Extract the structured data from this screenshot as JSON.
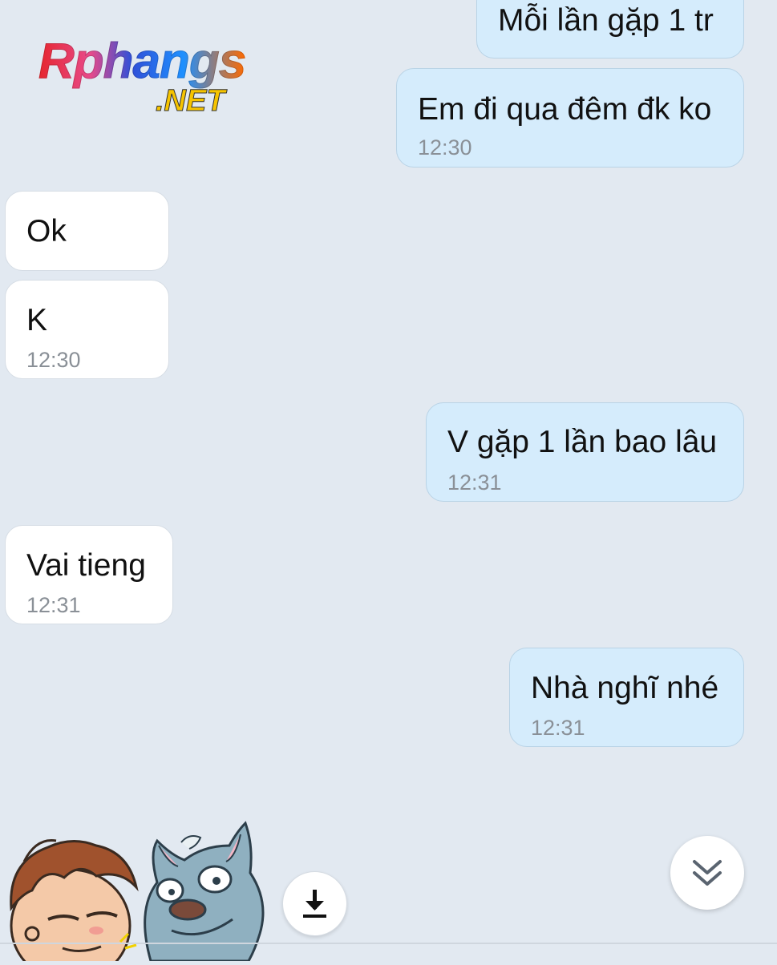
{
  "watermark": {
    "brand": "Rphangs",
    "domain": ".NET"
  },
  "messages": [
    {
      "side": "out",
      "text": "Mỗi lần gặp 1 tr",
      "time": ""
    },
    {
      "side": "out",
      "text": "Em đi qua đêm đk ko",
      "time": "12:30"
    },
    {
      "side": "in",
      "text": "Ok",
      "time": ""
    },
    {
      "side": "in",
      "text": "K",
      "time": "12:30"
    },
    {
      "side": "out",
      "text": "V gặp 1 lần bao lâu",
      "time": "12:31"
    },
    {
      "side": "in",
      "text": "Vai tieng",
      "time": "12:31"
    },
    {
      "side": "out",
      "text": "Nhà nghĩ nhé",
      "time": "12:31"
    }
  ],
  "icons": {
    "download": "download-icon",
    "scroll_down": "chevron-double-down-icon"
  },
  "colors": {
    "background": "#e2e9f1",
    "outgoing_bubble": "#d5ecfc",
    "incoming_bubble": "#ffffff",
    "timestamp": "#8a9097"
  }
}
